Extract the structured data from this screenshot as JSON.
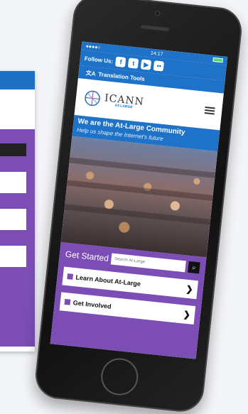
{
  "status": {
    "time": "14:17"
  },
  "header": {
    "follow_label": "Follow Us:",
    "social_icons": [
      "facebook-icon",
      "twitter-icon",
      "youtube-icon",
      "flickr-icon"
    ],
    "translation_label": "Translation Tools"
  },
  "logo": {
    "name": "ICANN",
    "sub": "AT-LARGE"
  },
  "hero": {
    "title": "We are the At-Large Community",
    "subtitle": "Help us shape the Internet's future"
  },
  "get_started": {
    "label": "Get Started",
    "search_placeholder": "Search At-Large"
  },
  "menu": [
    {
      "label": "Learn About At-Large"
    },
    {
      "label": "Get Involved"
    }
  ],
  "colors": {
    "brand_blue": "#1e73c9",
    "purple": "#7b4db5"
  }
}
